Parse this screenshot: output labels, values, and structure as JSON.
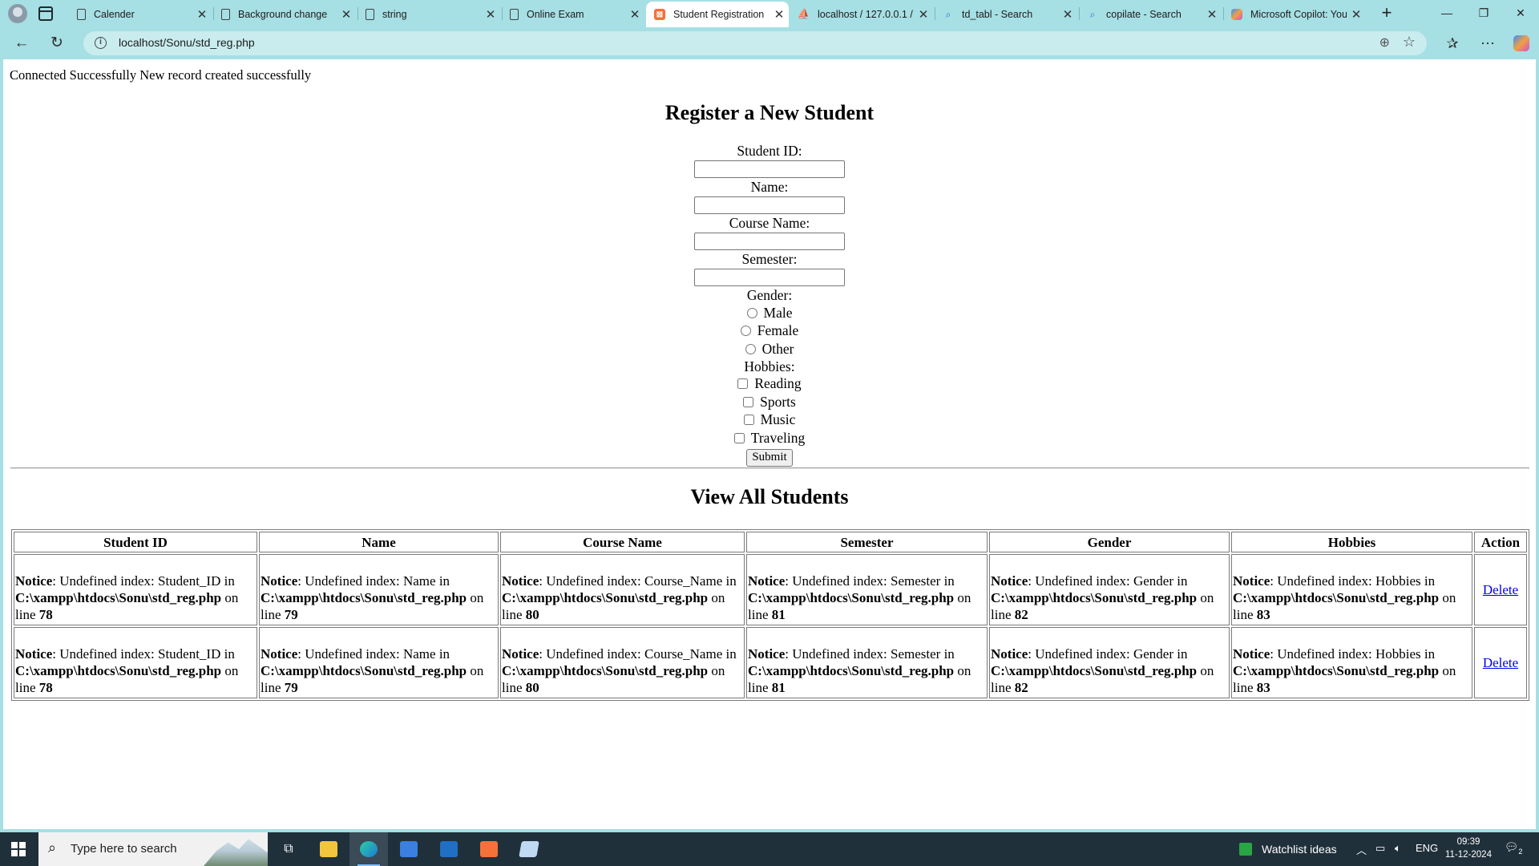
{
  "browser": {
    "tabs": [
      {
        "label": "Calender",
        "icon": "page-icon",
        "active": false
      },
      {
        "label": "Background change",
        "icon": "page-icon",
        "active": false
      },
      {
        "label": "string",
        "icon": "page-icon",
        "active": false
      },
      {
        "label": "Online Exam",
        "icon": "page-icon",
        "active": false
      },
      {
        "label": "Student Registration",
        "icon": "xampp-icon",
        "active": true
      },
      {
        "label": "localhost / 127.0.0.1 / ",
        "icon": "phpmyadmin-icon",
        "active": false
      },
      {
        "label": "td_tabl - Search",
        "icon": "search-icon",
        "active": false
      },
      {
        "label": "copilate - Search",
        "icon": "search-icon",
        "active": false
      },
      {
        "label": "Microsoft Copilot: You",
        "icon": "copilot-icon",
        "active": false
      }
    ],
    "url": "localhost/Sonu/std_reg.php",
    "chrome_color": "#a6dfe4"
  },
  "page": {
    "status_message": "Connected Successfully New record created successfully",
    "register_heading": "Register a New Student",
    "form": {
      "student_id_label": "Student ID:",
      "name_label": "Name:",
      "course_label": "Course Name:",
      "semester_label": "Semester:",
      "gender_label": "Gender:",
      "gender_options": [
        "Male",
        "Female",
        "Other"
      ],
      "hobbies_label": "Hobbies:",
      "hobby_options": [
        "Reading",
        "Sports",
        "Music",
        "Traveling"
      ],
      "submit_label": "Submit"
    },
    "view_heading": "View All Students",
    "table": {
      "headers": [
        "Student ID",
        "Name",
        "Course Name",
        "Semester",
        "Gender",
        "Hobbies",
        "Action"
      ],
      "notice_word": "Notice",
      "notice_path": "C:\\xampp\\htdocs\\Sonu\\std_reg.php",
      "notice_cells": [
        {
          "index": "Student_ID",
          "line": "78"
        },
        {
          "index": "Name",
          "line": "79"
        },
        {
          "index": "Course_Name",
          "line": "80"
        },
        {
          "index": "Semester",
          "line": "81"
        },
        {
          "index": "Gender",
          "line": "82"
        },
        {
          "index": "Hobbies",
          "line": "83"
        }
      ],
      "row_count": 2,
      "action_label": "Delete",
      "link_color": "#0000ee"
    }
  },
  "taskbar": {
    "search_placeholder": "Type here to search",
    "weather_label": "Watchlist ideas",
    "language": "ENG",
    "time": "09:39",
    "date": "11-12-2024",
    "notification_count": "2",
    "color": "#20303b"
  }
}
